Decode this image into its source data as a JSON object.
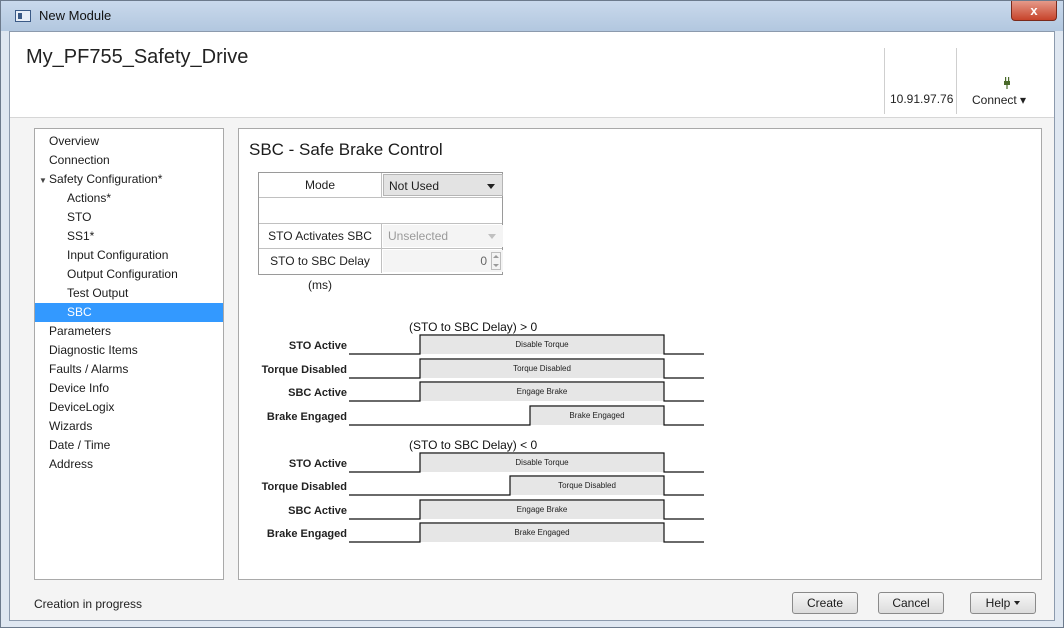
{
  "window": {
    "title": "New Module",
    "close_label": "x"
  },
  "header": {
    "module_name": "My_PF755_Safety_Drive",
    "ip_address": "10.91.97.76",
    "connect_label": "Connect ▾"
  },
  "sidebar": {
    "items": [
      {
        "label": "Overview"
      },
      {
        "label": "Connection"
      },
      {
        "label": "Safety Configuration*",
        "expanded": true
      },
      {
        "label": "Actions*"
      },
      {
        "label": "STO"
      },
      {
        "label": "SS1*"
      },
      {
        "label": "Input Configuration"
      },
      {
        "label": "Output Configuration"
      },
      {
        "label": "Test Output"
      },
      {
        "label": "SBC",
        "selected": true
      },
      {
        "label": "Parameters"
      },
      {
        "label": "Diagnostic Items"
      },
      {
        "label": "Faults / Alarms"
      },
      {
        "label": "Device Info"
      },
      {
        "label": "DeviceLogix"
      },
      {
        "label": "Wizards"
      },
      {
        "label": "Date / Time"
      },
      {
        "label": "Address"
      }
    ]
  },
  "panel": {
    "title": "SBC - Safe Brake Control",
    "mode_label": "Mode",
    "mode_value": "Not Used",
    "sto_activates_label": "STO Activates SBC",
    "sto_activates_value": "Unselected",
    "delay_label": "STO to SBC Delay (ms)",
    "delay_value": "0"
  },
  "diagram1": {
    "title": "(STO to SBC Delay) > 0",
    "rows": [
      {
        "label": "STO Active",
        "text": "Disable Torque"
      },
      {
        "label": "Torque Disabled",
        "text": "Torque Disabled"
      },
      {
        "label": "SBC Active",
        "text": "Engage Brake"
      },
      {
        "label": "Brake Engaged",
        "text": "Brake Engaged"
      }
    ]
  },
  "diagram2": {
    "title": "(STO to SBC Delay) < 0",
    "rows": [
      {
        "label": "STO Active",
        "text": "Disable Torque"
      },
      {
        "label": "Torque Disabled",
        "text": "Torque Disabled"
      },
      {
        "label": "SBC Active",
        "text": "Engage Brake"
      },
      {
        "label": "Brake Engaged",
        "text": "Brake Engaged"
      }
    ]
  },
  "footer": {
    "status": "Creation in progress",
    "create_label": "Create",
    "cancel_label": "Cancel",
    "help_label": "Help"
  },
  "colors": {
    "selection": "#3399ff",
    "close_button": "#c7432b"
  }
}
